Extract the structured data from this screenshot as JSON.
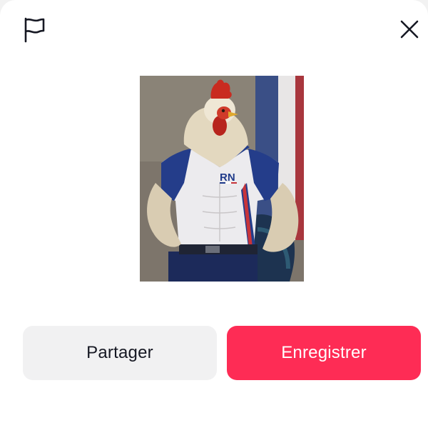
{
  "dialog": {
    "report_icon": "flag-icon",
    "close_icon": "close-icon",
    "image": {
      "subject": "muscular rooster mascot in polo shirt",
      "shirt_logo": "RN"
    },
    "actions": {
      "share_label": "Partager",
      "save_label": "Enregistrer"
    }
  },
  "colors": {
    "save_button": "#fe2c55",
    "share_button": "#f1f1f2",
    "text_dark": "#161823"
  }
}
